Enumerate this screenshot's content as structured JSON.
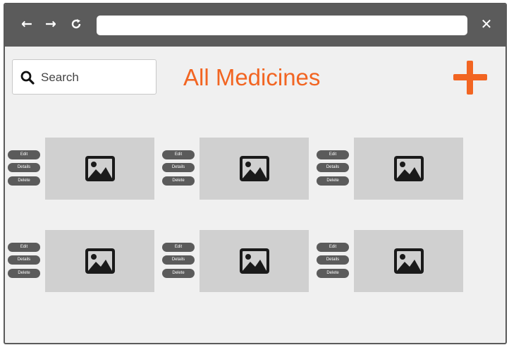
{
  "browser": {
    "back_icon": "arrow-left-icon",
    "forward_icon": "arrow-right-icon",
    "reload_icon": "reload-icon",
    "close_icon": "close-icon",
    "address_value": ""
  },
  "search": {
    "label": "Search",
    "icon": "search-icon"
  },
  "page": {
    "title": "All Medicines",
    "accent_color": "#f26522"
  },
  "add_button": {
    "icon": "plus-icon"
  },
  "cards": [
    {
      "actions": {
        "edit": "Edit",
        "details": "Details",
        "delete": "Delete"
      },
      "image_icon": "image-placeholder-icon"
    },
    {
      "actions": {
        "edit": "Edit",
        "details": "Details",
        "delete": "Delete"
      },
      "image_icon": "image-placeholder-icon"
    },
    {
      "actions": {
        "edit": "Edit",
        "details": "Details",
        "delete": "Delete"
      },
      "image_icon": "image-placeholder-icon"
    },
    {
      "actions": {
        "edit": "Edit",
        "details": "Details",
        "delete": "Delete"
      },
      "image_icon": "image-placeholder-icon"
    },
    {
      "actions": {
        "edit": "Edit",
        "details": "Details",
        "delete": "Delete"
      },
      "image_icon": "image-placeholder-icon"
    },
    {
      "actions": {
        "edit": "Edit",
        "details": "Details",
        "delete": "Delete"
      },
      "image_icon": "image-placeholder-icon"
    }
  ]
}
